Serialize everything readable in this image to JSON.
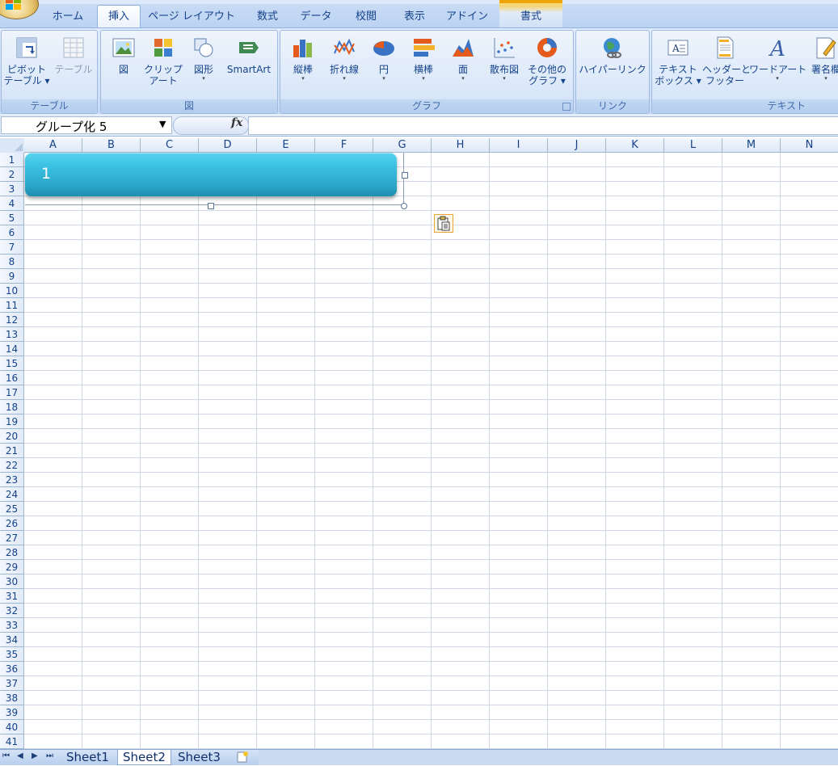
{
  "tabs": [
    {
      "label": "ホーム",
      "active": false
    },
    {
      "label": "挿入",
      "active": true
    },
    {
      "label": "ページ レイアウト",
      "active": false
    },
    {
      "label": "数式",
      "active": false
    },
    {
      "label": "データ",
      "active": false
    },
    {
      "label": "校閲",
      "active": false
    },
    {
      "label": "表示",
      "active": false
    },
    {
      "label": "アドイン",
      "active": false
    },
    {
      "label": "書式",
      "active": false,
      "contextual": true
    }
  ],
  "ribbon": {
    "groups": [
      {
        "label": "テーブル",
        "buttons": [
          {
            "line1": "ピボット",
            "line2": "テーブル ▾",
            "icon": "pivot-table-icon",
            "enabled": true
          },
          {
            "line1": "テーブル",
            "line2": "",
            "icon": "table-icon",
            "enabled": false
          }
        ]
      },
      {
        "label": "図",
        "buttons": [
          {
            "line1": "図",
            "line2": "",
            "icon": "picture-icon",
            "enabled": true
          },
          {
            "line1": "クリップ",
            "line2": "アート",
            "icon": "clip-art-icon",
            "enabled": true
          },
          {
            "line1": "図形",
            "line2": "▾",
            "icon": "shapes-icon",
            "enabled": true
          },
          {
            "line1": "SmartArt",
            "line2": "",
            "icon": "smartart-icon",
            "enabled": true
          }
        ]
      },
      {
        "label": "グラフ",
        "buttons": [
          {
            "line1": "縦棒",
            "line2": "▾",
            "icon": "column-chart-icon",
            "enabled": true
          },
          {
            "line1": "折れ線",
            "line2": "▾",
            "icon": "line-chart-icon",
            "enabled": true
          },
          {
            "line1": "円",
            "line2": "▾",
            "icon": "pie-chart-icon",
            "enabled": true
          },
          {
            "line1": "横棒",
            "line2": "▾",
            "icon": "bar-chart-icon",
            "enabled": true
          },
          {
            "line1": "面",
            "line2": "▾",
            "icon": "area-chart-icon",
            "enabled": true
          },
          {
            "line1": "散布図",
            "line2": "▾",
            "icon": "scatter-chart-icon",
            "enabled": true
          },
          {
            "line1": "その他の",
            "line2": "グラフ ▾",
            "icon": "other-charts-icon",
            "enabled": true
          }
        ]
      },
      {
        "label": "リンク",
        "buttons": [
          {
            "line1": "ハイパーリンク",
            "line2": "",
            "icon": "hyperlink-icon",
            "enabled": true
          }
        ]
      },
      {
        "label": "テキスト",
        "buttons": [
          {
            "line1": "テキスト",
            "line2": "ボックス ▾",
            "icon": "text-box-icon",
            "enabled": true
          },
          {
            "line1": "ヘッダーと",
            "line2": "フッター",
            "icon": "header-footer-icon",
            "enabled": true
          },
          {
            "line1": "ワードアート",
            "line2": "▾",
            "icon": "wordart-icon",
            "enabled": true
          },
          {
            "line1": "署名欄",
            "line2": "▾",
            "icon": "signature-icon",
            "enabled": true
          }
        ]
      }
    ]
  },
  "formula_bar": {
    "name_box": "グループ化 5",
    "fx": "fx",
    "formula": ""
  },
  "grid": {
    "columns": [
      "A",
      "B",
      "C",
      "D",
      "E",
      "F",
      "G",
      "H",
      "I",
      "J",
      "K",
      "L",
      "M",
      "N"
    ],
    "rows": [
      "1",
      "2",
      "3",
      "4",
      "5",
      "6",
      "7",
      "8",
      "9",
      "10",
      "11",
      "12",
      "13",
      "14",
      "15",
      "16",
      "17",
      "18",
      "19",
      "20",
      "21",
      "22",
      "23",
      "24",
      "25",
      "26",
      "27",
      "28",
      "29",
      "30",
      "31",
      "32",
      "33",
      "34",
      "35",
      "36",
      "37",
      "38",
      "39",
      "40",
      "41"
    ]
  },
  "shape": {
    "text": "1",
    "color": "#2fb3d6"
  },
  "sheets": [
    {
      "label": "Sheet1",
      "active": false
    },
    {
      "label": "Sheet2",
      "active": true
    },
    {
      "label": "Sheet3",
      "active": false
    }
  ],
  "sheet_nav": [
    "⏮",
    "◀",
    "▶",
    "⏭"
  ]
}
